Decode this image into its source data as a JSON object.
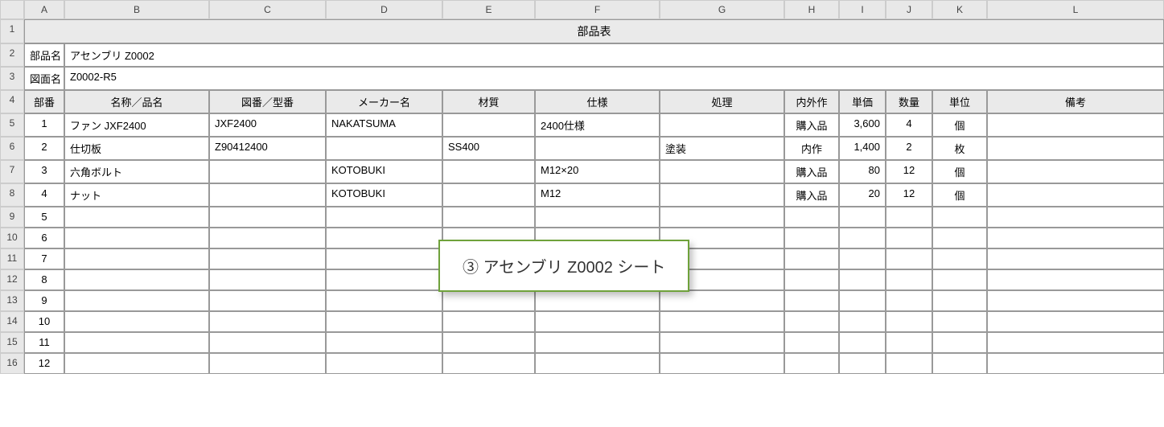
{
  "columns": [
    "A",
    "B",
    "C",
    "D",
    "E",
    "F",
    "G",
    "H",
    "I",
    "J",
    "K",
    "L"
  ],
  "rowHeaders": [
    "1",
    "2",
    "3",
    "4",
    "5",
    "6",
    "7",
    "8",
    "9",
    "10",
    "11",
    "12",
    "13",
    "14",
    "15",
    "16"
  ],
  "title": "部品表",
  "meta": {
    "partNameLabel": "部品名",
    "partNameValue": "アセンブリ Z0002",
    "drawingLabel": "図面名",
    "drawingValue": "Z0002-R5"
  },
  "headers": {
    "no": "部番",
    "name": "名称／品名",
    "drawNo": "図番／型番",
    "maker": "メーカー名",
    "material": "材質",
    "spec": "仕様",
    "treatment": "処理",
    "inout": "内外作",
    "price": "単価",
    "qty": "数量",
    "unit": "単位",
    "remarks": "備考"
  },
  "rows": [
    {
      "no": "1",
      "name": "ファン JXF2400",
      "drawNo": "JXF2400",
      "maker": "NAKATSUMA",
      "material": "",
      "spec": "2400仕様",
      "treatment": "",
      "inout": "購入品",
      "price": "3,600",
      "qty": "4",
      "unit": "個",
      "remarks": ""
    },
    {
      "no": "2",
      "name": "仕切板",
      "drawNo": "Z90412400",
      "maker": "",
      "material": "SS400",
      "spec": "",
      "treatment": "塗装",
      "inout": "内作",
      "price": "1,400",
      "qty": "2",
      "unit": "枚",
      "remarks": ""
    },
    {
      "no": "3",
      "name": "六角ボルト",
      "drawNo": "",
      "maker": "KOTOBUKI",
      "material": "",
      "spec": "M12×20",
      "treatment": "",
      "inout": "購入品",
      "price": "80",
      "qty": "12",
      "unit": "個",
      "remarks": ""
    },
    {
      "no": "4",
      "name": "ナット",
      "drawNo": "",
      "maker": "KOTOBUKI",
      "material": "",
      "spec": "M12",
      "treatment": "",
      "inout": "購入品",
      "price": "20",
      "qty": "12",
      "unit": "個",
      "remarks": ""
    },
    {
      "no": "5",
      "name": "",
      "drawNo": "",
      "maker": "",
      "material": "",
      "spec": "",
      "treatment": "",
      "inout": "",
      "price": "",
      "qty": "",
      "unit": "",
      "remarks": ""
    },
    {
      "no": "6",
      "name": "",
      "drawNo": "",
      "maker": "",
      "material": "",
      "spec": "",
      "treatment": "",
      "inout": "",
      "price": "",
      "qty": "",
      "unit": "",
      "remarks": ""
    },
    {
      "no": "7",
      "name": "",
      "drawNo": "",
      "maker": "",
      "material": "",
      "spec": "",
      "treatment": "",
      "inout": "",
      "price": "",
      "qty": "",
      "unit": "",
      "remarks": ""
    },
    {
      "no": "8",
      "name": "",
      "drawNo": "",
      "maker": "",
      "material": "",
      "spec": "",
      "treatment": "",
      "inout": "",
      "price": "",
      "qty": "",
      "unit": "",
      "remarks": ""
    },
    {
      "no": "9",
      "name": "",
      "drawNo": "",
      "maker": "",
      "material": "",
      "spec": "",
      "treatment": "",
      "inout": "",
      "price": "",
      "qty": "",
      "unit": "",
      "remarks": ""
    },
    {
      "no": "10",
      "name": "",
      "drawNo": "",
      "maker": "",
      "material": "",
      "spec": "",
      "treatment": "",
      "inout": "",
      "price": "",
      "qty": "",
      "unit": "",
      "remarks": ""
    },
    {
      "no": "11",
      "name": "",
      "drawNo": "",
      "maker": "",
      "material": "",
      "spec": "",
      "treatment": "",
      "inout": "",
      "price": "",
      "qty": "",
      "unit": "",
      "remarks": ""
    },
    {
      "no": "12",
      "name": "",
      "drawNo": "",
      "maker": "",
      "material": "",
      "spec": "",
      "treatment": "",
      "inout": "",
      "price": "",
      "qty": "",
      "unit": "",
      "remarks": ""
    }
  ],
  "callout": "③ アセンブリ Z0002 シート"
}
